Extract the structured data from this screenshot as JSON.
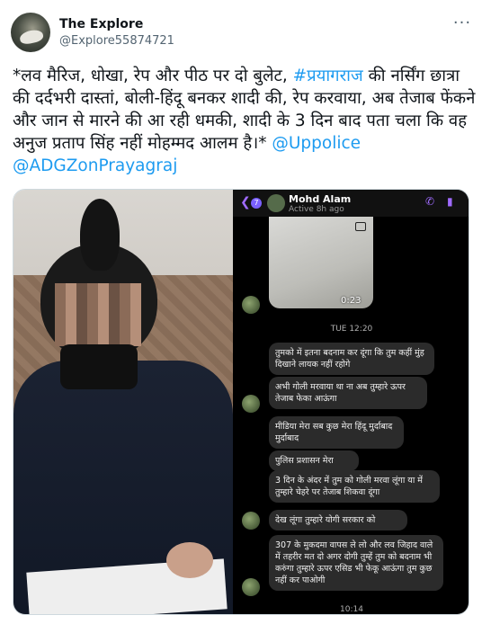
{
  "tweet": {
    "author_name": "The Explore",
    "author_handle": "@Explore55874721",
    "more_label": "···",
    "text_intro": "*लव मैरिज, धोखा, रेप और पीठ पर दो बुलेट, ",
    "hashtag": "#प्रयागराज",
    "text_body": " की नर्सिंग छात्रा की दर्दभरी दास्तां, बोली-हिंदू बनकर शादी की, रेप करवाया, अब तेजाब फेंकने और जान से मारने की आ रही धमकी, शादी के 3 दिन बाद पता चला कि वह अनुज प्रताप सिंह नहीं मोहम्मद आलम है।* ",
    "mention_1": "@Uppolice",
    "mention_2": "@ADGZonPrayagraj"
  },
  "chat": {
    "badge_count": "7",
    "contact_name": "Mohd Alam",
    "active_status": "Active 8h ago",
    "video_duration": "0:23",
    "day_time": "TUE 12:20",
    "bottom_time": "10:14",
    "messages": [
      "तुमको में इतना बदनाम कर दूंगा कि तुम कहीं मुंह दिखाने लायक नहीं रहोगे",
      "अभी गोली मरवाया था ना अब तुम्हारे ऊपर तेजाब फेका आऊंगा",
      "मीडिया मेरा सब कुछ मेरा हिंदू मुर्दाबाद मुर्दाबाद",
      "पुलिस प्रशासन मेरा",
      "3 दिन के अंदर में तुम को गोली मरवा लूंगा या में तुम्हारे चेहरे पर तेजाब शिकवा दूंगा",
      "देख लूंगा तुम्हारे योगी सरकार को",
      "307 के मुकदमा वापस ले लो और लव जिहाद वाले में तहरीर मत दो अगर दोगी तुम्हें तुम को बदनाम भी करुंगा तुम्हारे ऊपर एसिड भी फेकू आऊंगा तुम कुछ नहीं कर पाओगी"
    ]
  },
  "colors": {
    "link": "#1d9bf0",
    "chat_bg": "#000000",
    "bubble": "#2b2b2b",
    "accent_purple": "#a06bff"
  }
}
